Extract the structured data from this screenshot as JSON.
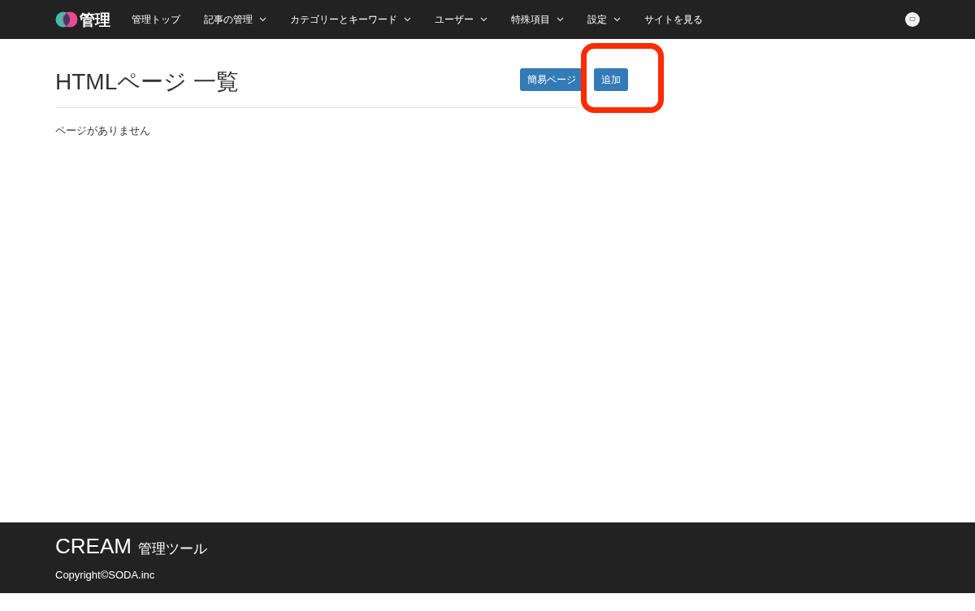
{
  "nav": {
    "logo_text": "管理",
    "items": [
      {
        "label": "管理トップ",
        "dropdown": false
      },
      {
        "label": "記事の管理",
        "dropdown": true
      },
      {
        "label": "カテゴリーとキーワード",
        "dropdown": true
      },
      {
        "label": "ユーザー",
        "dropdown": true
      },
      {
        "label": "特殊項目",
        "dropdown": true
      },
      {
        "label": "設定",
        "dropdown": true
      },
      {
        "label": "サイトを見る",
        "dropdown": false
      }
    ]
  },
  "page": {
    "title": "HTMLページ 一覧",
    "buttons": [
      {
        "label": "簡易ページ",
        "highlighted": false
      },
      {
        "label": "追加",
        "highlighted": true
      }
    ],
    "empty_message": "ページがありません"
  },
  "footer": {
    "brand": "CREAM",
    "subtitle": "管理ツール",
    "copyright": "Copyright©SODA.inc"
  }
}
